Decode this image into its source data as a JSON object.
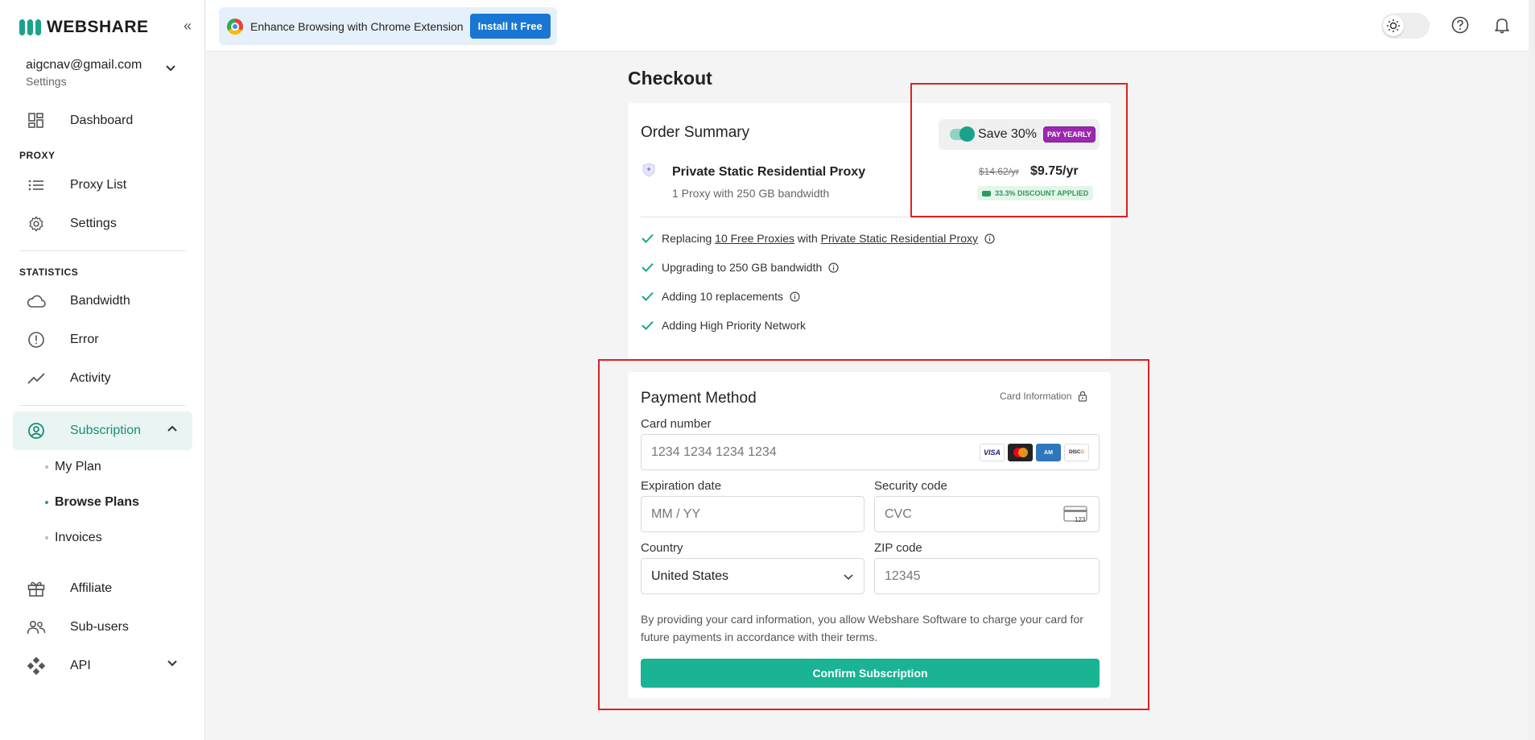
{
  "sidebar": {
    "brand": "WEBSHARE",
    "account": {
      "email": "aigcnav@gmail.com",
      "sub": "Settings"
    },
    "dashboard": "Dashboard",
    "section_proxy": "PROXY",
    "proxy_list": "Proxy List",
    "settings": "Settings",
    "section_statistics": "STATISTICS",
    "bandwidth": "Bandwidth",
    "error": "Error",
    "activity": "Activity",
    "subscription": "Subscription",
    "sub_items": [
      "My Plan",
      "Browse Plans",
      "Invoices"
    ],
    "affiliate": "Affiliate",
    "sub_users": "Sub-users",
    "api": "API"
  },
  "topbar": {
    "promo_text": "Enhance Browsing with Chrome Extension",
    "promo_button": "Install It Free"
  },
  "checkout": {
    "title": "Checkout",
    "order": {
      "title": "Order Summary",
      "save_label": "Save 30%",
      "pay_badge": "PAY YEARLY",
      "product_name": "Private Static Residential Proxy",
      "product_desc": "1 Proxy with 250 GB bandwidth",
      "old_price": "$14.62/yr",
      "new_price": "$9.75/yr",
      "discount": "33.3% DISCOUNT APPLIED",
      "features": {
        "f1_a": "Replacing ",
        "f1_link1": "10 Free Proxies",
        "f1_b": " with ",
        "f1_link2": "Private Static Residential Proxy",
        "f2": "Upgrading to 250 GB bandwidth",
        "f3": "Adding 10 replacements",
        "f4": "Adding High Priority Network"
      }
    },
    "payment": {
      "title": "Payment Method",
      "card_info": "Card Information",
      "card_number_label": "Card number",
      "card_number_placeholder": "1234 1234 1234 1234",
      "brands": [
        "VISA",
        "MC",
        "AMEX",
        "DISCOVER"
      ],
      "expiration_label": "Expiration date",
      "expiration_placeholder": "MM / YY",
      "security_label": "Security code",
      "security_placeholder": "CVC",
      "cvc_icon_text": "123",
      "country_label": "Country",
      "country_value": "United States",
      "zip_label": "ZIP code",
      "zip_placeholder": "12345",
      "disclaimer": "By providing your card information, you allow Webshare Software to charge your card for future payments in accordance with their terms.",
      "confirm": "Confirm Subscription"
    }
  },
  "colors": {
    "accent": "#1ab394",
    "brand": "#1aa38a",
    "highlight": "#e02020",
    "badge": "#9c27b0",
    "promo_button": "#1976d2"
  }
}
